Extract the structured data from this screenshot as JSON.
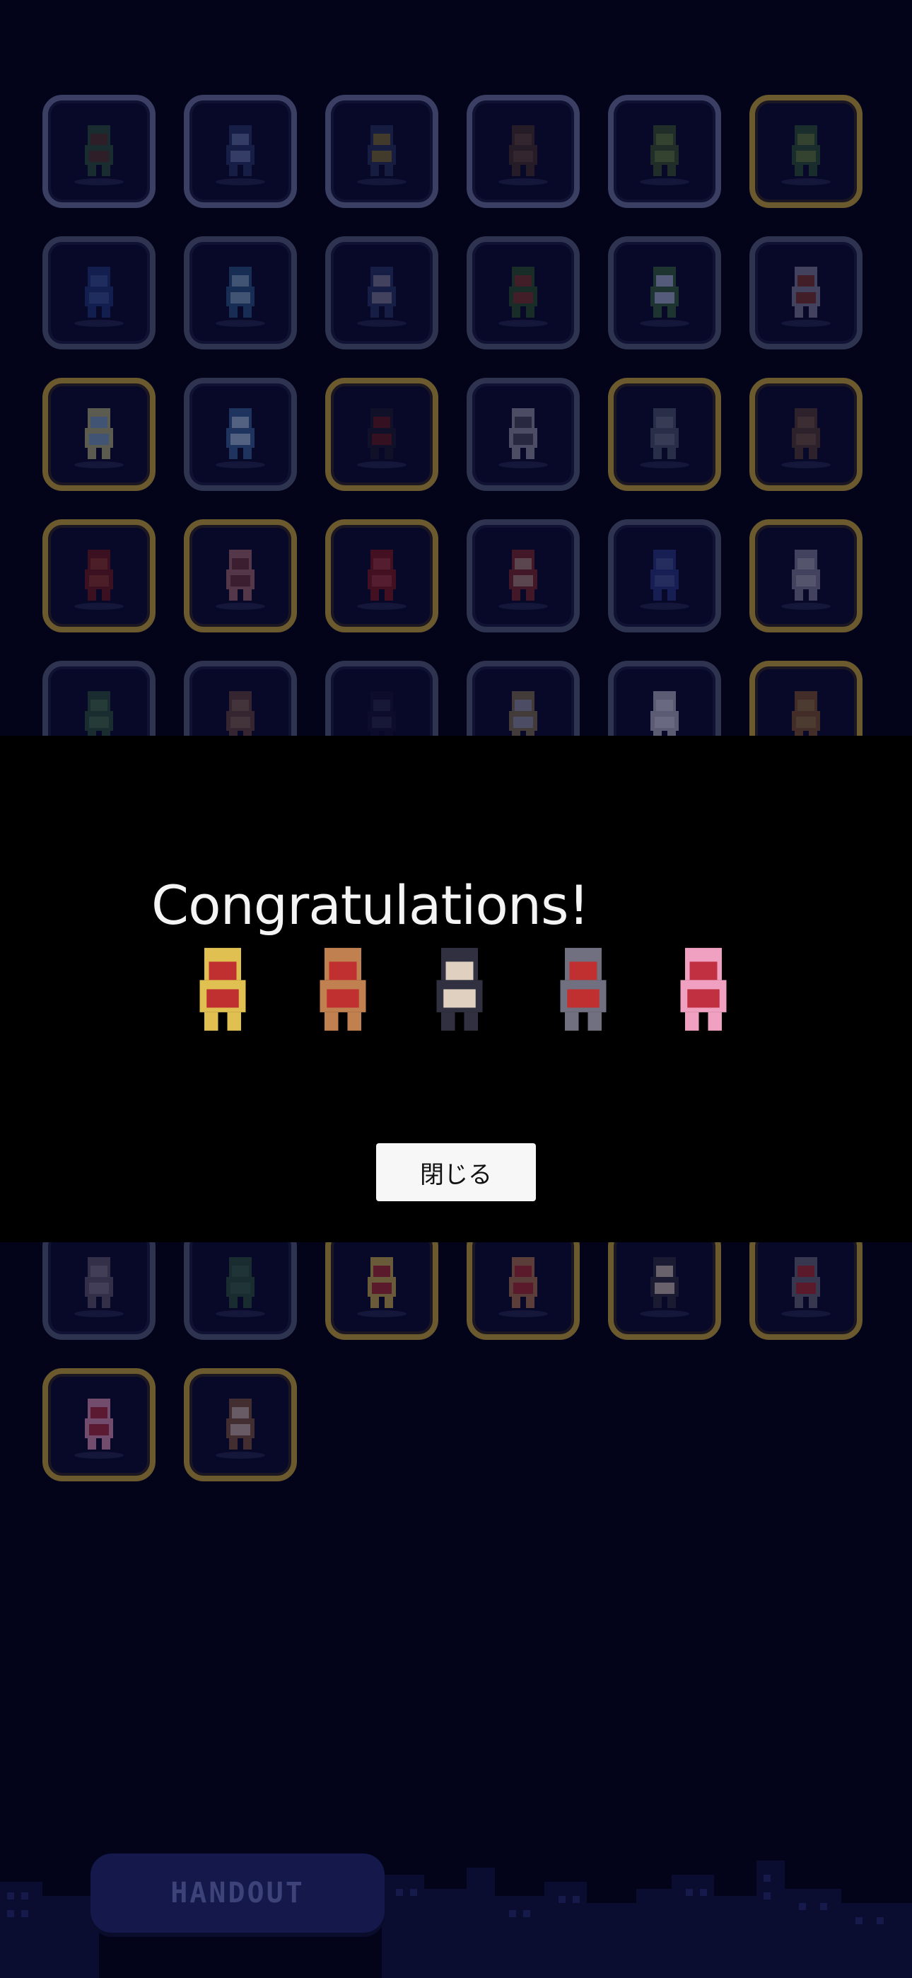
{
  "overlay": {
    "title": "Congratulations!",
    "close_label": "閉じる",
    "heroes": [
      {
        "icon": "blonde-girl-red-ribbon-icon"
      },
      {
        "icon": "mohawk-warrior-spear-icon"
      },
      {
        "icon": "black-hair-swordsman-icon"
      },
      {
        "icon": "armored-knight-icon"
      },
      {
        "icon": "pink-twintail-girl-icon"
      }
    ]
  },
  "grid": {
    "cells": [
      {
        "icon": "orc-warrior-icon",
        "frame": "silver"
      },
      {
        "icon": "shark-beast-icon",
        "frame": "silver"
      },
      {
        "icon": "dark-bird-icon",
        "frame": "silver"
      },
      {
        "icon": "bear-icon",
        "frame": "silver"
      },
      {
        "icon": "snake-icon",
        "frame": "silver"
      },
      {
        "icon": "green-dragon-icon",
        "frame": "gold"
      },
      {
        "icon": "slime-icon",
        "frame": "plain"
      },
      {
        "icon": "fish-icon",
        "frame": "plain"
      },
      {
        "icon": "snail-icon",
        "frame": "plain"
      },
      {
        "icon": "plant-monster-icon",
        "frame": "plain"
      },
      {
        "icon": "flower-frog-icon",
        "frame": "plain"
      },
      {
        "icon": "wasp-icon",
        "frame": "plain"
      },
      {
        "icon": "fairy-icon",
        "frame": "gold"
      },
      {
        "icon": "orb-icon",
        "frame": "plain"
      },
      {
        "icon": "shadow-ghost-icon",
        "frame": "gold"
      },
      {
        "icon": "skeleton-icon",
        "frame": "plain"
      },
      {
        "icon": "zombie-icon",
        "frame": "gold"
      },
      {
        "icon": "golem-icon",
        "frame": "gold"
      },
      {
        "icon": "red-worm-icon",
        "frame": "gold"
      },
      {
        "icon": "pink-dancer-icon",
        "frame": "gold"
      },
      {
        "icon": "red-demon-icon",
        "frame": "gold"
      },
      {
        "icon": "red-hair-fighter-icon",
        "frame": "plain"
      },
      {
        "icon": "blue-mage-icon",
        "frame": "plain"
      },
      {
        "icon": "silver-knight-axe-icon",
        "frame": "gold"
      },
      {
        "icon": "green-archer-icon",
        "frame": "plain"
      },
      {
        "icon": "brown-villager-icon",
        "frame": "plain"
      },
      {
        "icon": "hooded-figure-icon",
        "frame": "plain"
      },
      {
        "icon": "sword-icon",
        "frame": "plain"
      },
      {
        "icon": "white-rabbit-icon",
        "frame": "plain"
      },
      {
        "icon": "diver-helmet-icon",
        "frame": "gold"
      },
      {
        "icon": "pigeon-icon",
        "frame": "plain"
      },
      {
        "icon": "goblin-icon",
        "frame": "plain"
      },
      {
        "icon": "blonde-girl-red-ribbon-icon",
        "frame": "gold"
      },
      {
        "icon": "mohawk-warrior-spear-icon",
        "frame": "gold"
      },
      {
        "icon": "black-hair-swordsman-icon",
        "frame": "gold"
      },
      {
        "icon": "armored-knight-icon",
        "frame": "gold"
      },
      {
        "icon": "pink-twintail-girl-icon",
        "frame": "gold"
      },
      {
        "icon": "brown-hair-girl-icon",
        "frame": "gold"
      }
    ]
  },
  "footer": {
    "handout_label": "HANDOUT"
  },
  "colors": {
    "background": "#03031a",
    "frame_silver": "#3a3f63",
    "frame_gold": "#6b5a2e",
    "overlay": "#000000"
  }
}
